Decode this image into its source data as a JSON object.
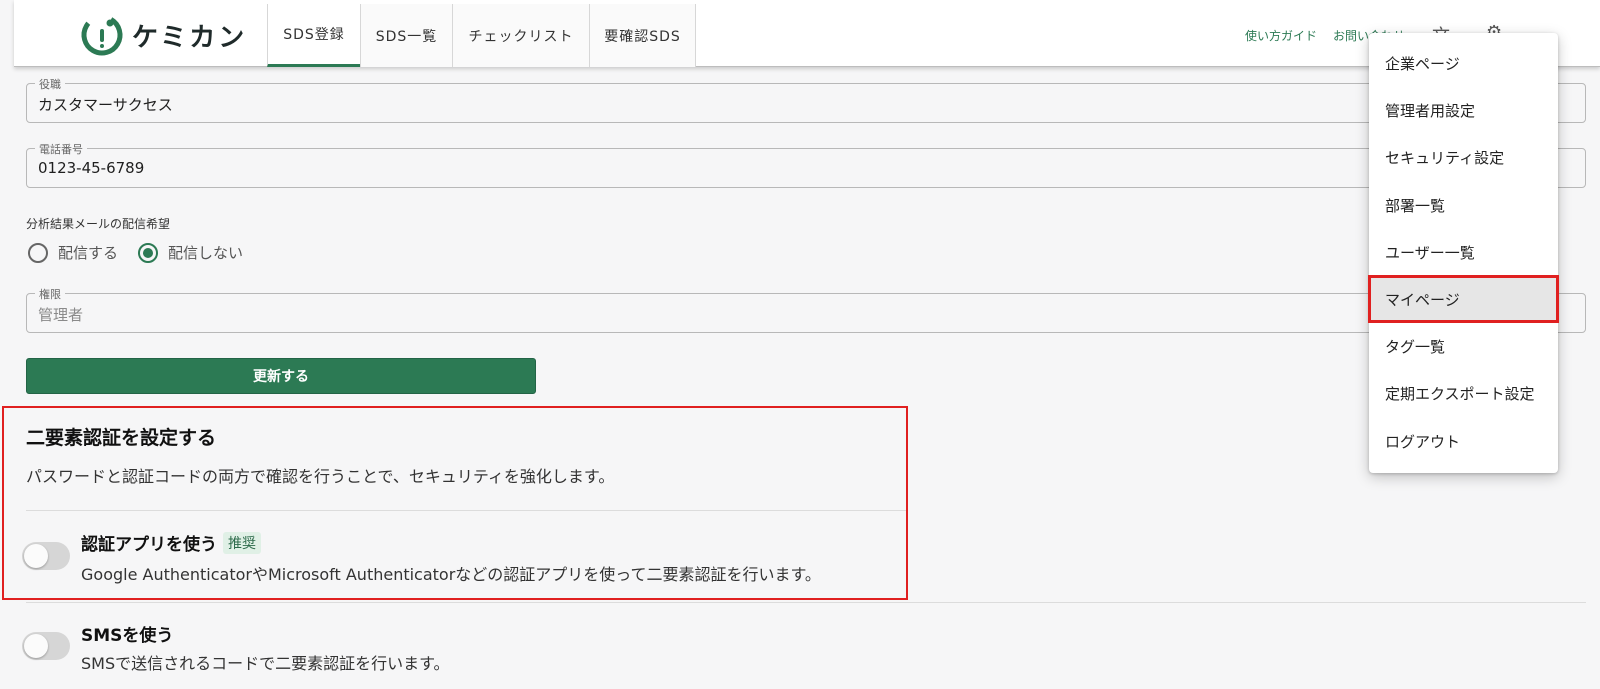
{
  "app": {
    "name": "ケミカン"
  },
  "nav": {
    "tabs": [
      {
        "label": "SDS登録",
        "active": true
      },
      {
        "label": "SDS一覧"
      },
      {
        "label": "チェックリスト"
      },
      {
        "label": "要確認SDS"
      }
    ]
  },
  "header": {
    "guide_link": "使い方ガイド",
    "contact_link": "お問い合わせ",
    "language_icon": "translate-icon",
    "settings_icon": "gear-icon"
  },
  "form": {
    "position": {
      "label": "役職",
      "value": "カスタマーサクセス"
    },
    "phone": {
      "label": "電話番号",
      "value": "0123-45-6789"
    },
    "mail_pref": {
      "label": "分析結果メールの配信希望",
      "options": [
        "配信する",
        "配信しない"
      ],
      "selected": "配信しない"
    },
    "role": {
      "label": "権限",
      "value": "管理者"
    },
    "update_button": "更新する"
  },
  "two_factor": {
    "title": "二要素認証を設定する",
    "description": "パスワードと認証コードの両方で確認を行うことで、セキュリティを強化します。",
    "app": {
      "title": "認証アプリを使う",
      "badge": "推奨",
      "description": "Google AuthenticatorやMicrosoft Authenticatorなどの認証アプリを使って二要素認証を行います。",
      "enabled": false
    },
    "sms": {
      "title": "SMSを使う",
      "description": "SMSで送信されるコードで二要素認証を行います。",
      "enabled": false
    }
  },
  "menu": {
    "items": [
      "企業ページ",
      "管理者用設定",
      "セキュリティ設定",
      "部署一覧",
      "ユーザー一覧",
      "マイページ",
      "タグ一覧",
      "定期エクスポート設定",
      "ログアウト"
    ],
    "selected": "マイページ"
  },
  "colors": {
    "brand": "#2c7a54",
    "highlight": "#e02020"
  }
}
